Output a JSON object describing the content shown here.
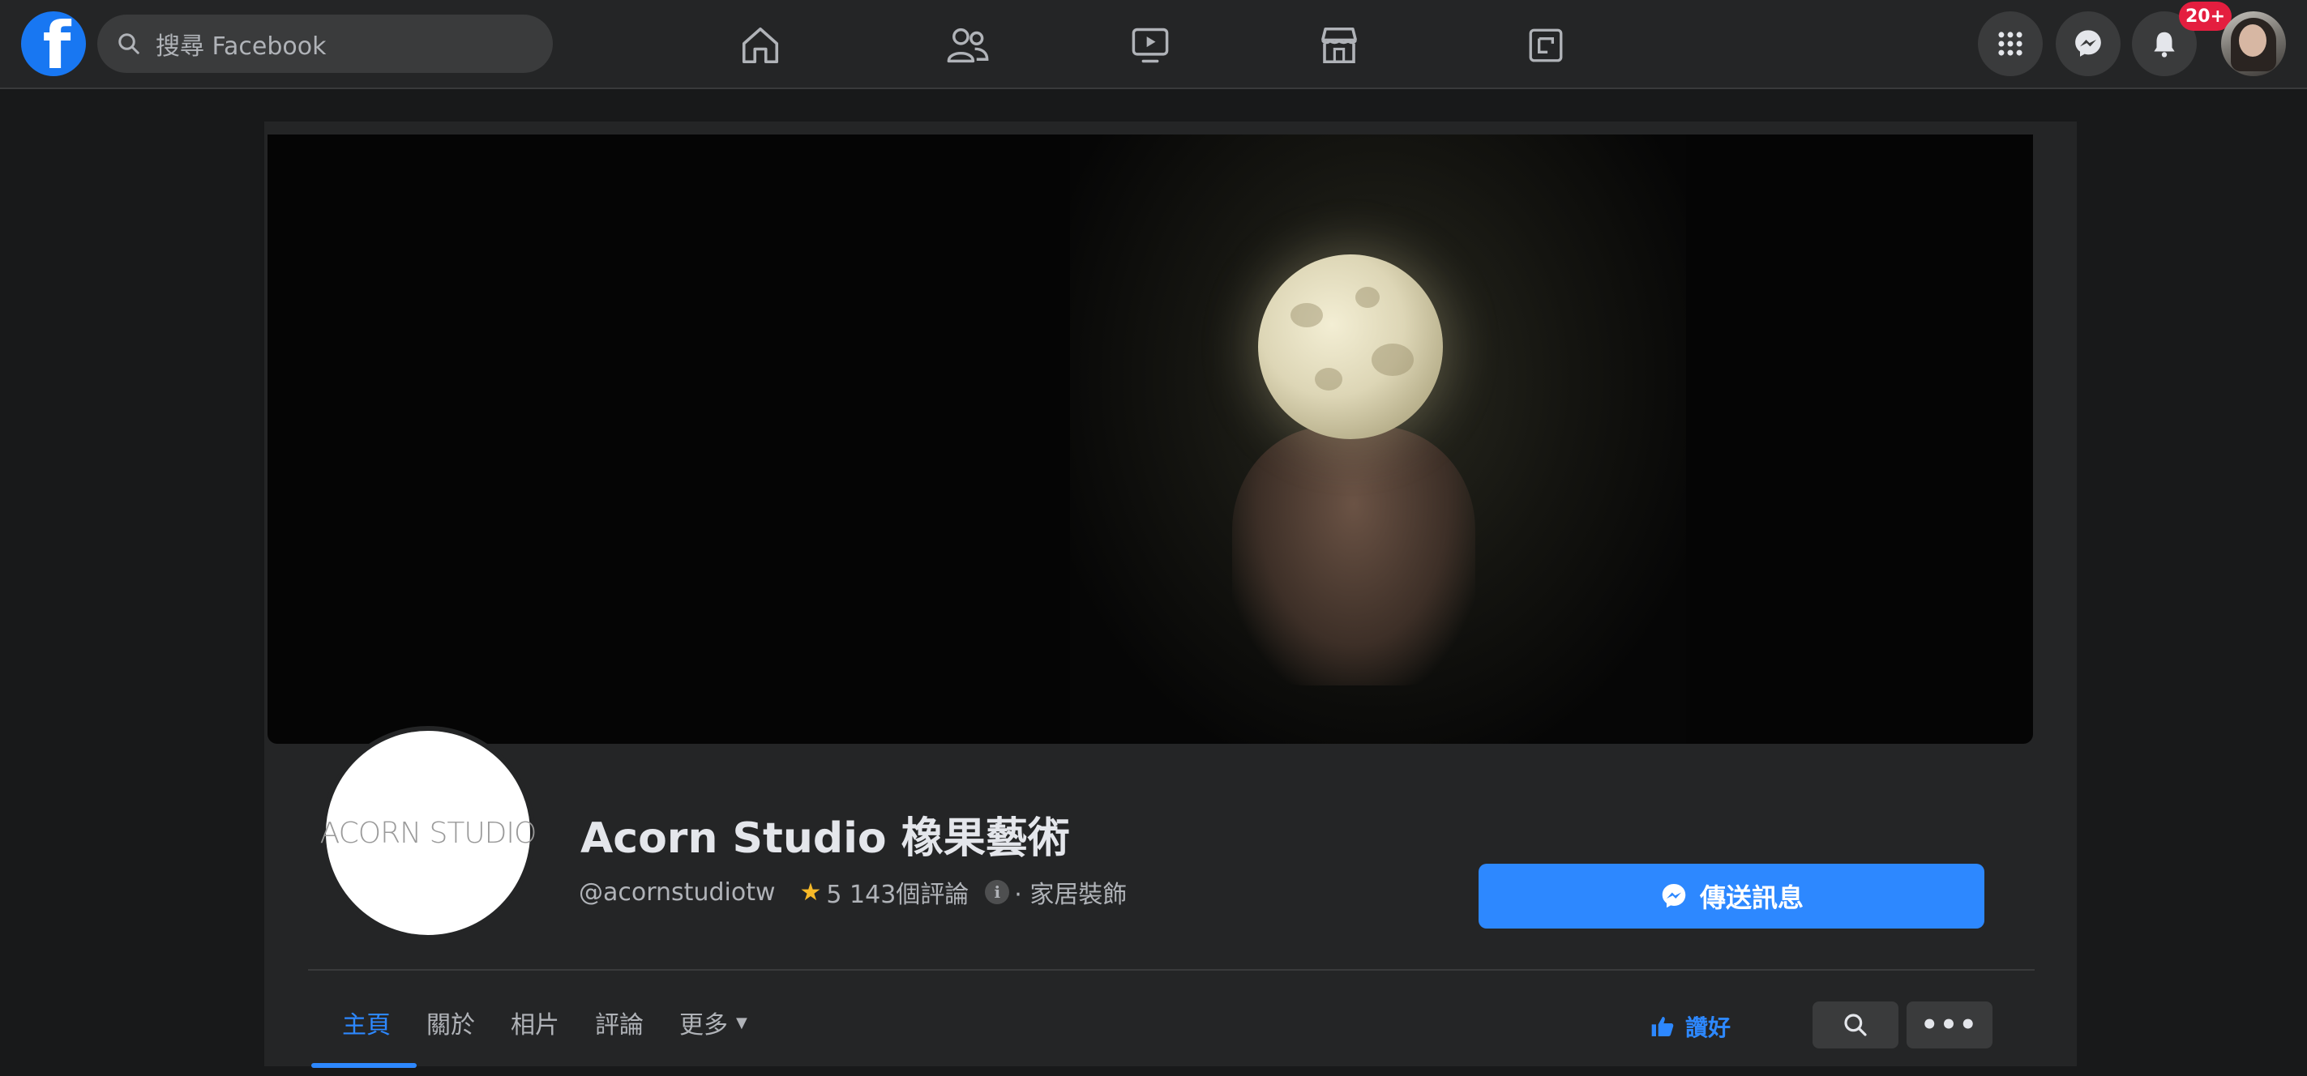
{
  "topbar": {
    "logo_letter": "f",
    "search_placeholder": "搜尋 Facebook",
    "nav_tabs": [
      "home",
      "friends",
      "watch",
      "marketplace",
      "gaming"
    ],
    "notification_count": "20+"
  },
  "page": {
    "logo_text": "ACORN STUDIO",
    "name": "Acorn Studio 橡果藝術",
    "handle": "@acornstudiotw",
    "rating": "5 143個評論",
    "category": "· 家居裝飾",
    "message_button": "傳送訊息",
    "tabs": [
      {
        "label": "主頁",
        "active": true
      },
      {
        "label": "關於",
        "active": false
      },
      {
        "label": "相片",
        "active": false
      },
      {
        "label": "評論",
        "active": false
      },
      {
        "label": "更多",
        "active": false
      }
    ],
    "more_caret": "▼",
    "like_button": "讚好",
    "dots": "•••"
  },
  "colors": {
    "accent": "#2d88ff",
    "topbar_bg": "#242526",
    "page_bg": "#18191a",
    "badge": "#e41e3f"
  },
  "icons": [
    "facebook-logo-icon",
    "search-icon",
    "home-icon",
    "friends-icon",
    "watch-icon",
    "marketplace-icon",
    "gaming-icon",
    "menu-grid-icon",
    "messenger-icon",
    "bell-icon",
    "star-icon",
    "info-icon",
    "thumbs-up-icon",
    "more-dots-icon"
  ]
}
